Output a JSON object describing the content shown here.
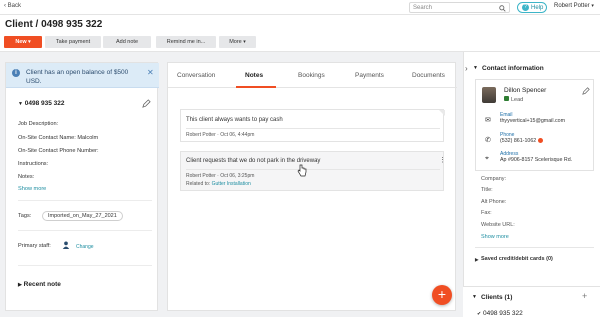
{
  "topbar": {
    "back_label": "Back",
    "search_placeholder": "Search",
    "help_label": "Help",
    "user_name": "Robert Potter"
  },
  "header": {
    "title": "Client / 0498 935 322",
    "buttons": {
      "new": "New",
      "take_payment": "Take payment",
      "add_note": "Add note",
      "remind_me": "Remind me in...",
      "more": "More"
    }
  },
  "left": {
    "alert_text": "Client has an open balance of $500 USD.",
    "phone": "0498 935 322",
    "fields": {
      "job_description": "Job Description:",
      "onsite_name": "On-Site Contact Name: Malcolm",
      "onsite_phone": "On-Site Contact Phone Number:",
      "instructions": "Instructions:",
      "notes": "Notes:"
    },
    "show_more": "Show more",
    "tags_label": "Tags:",
    "tag_value": "Imported_on_May_27_2021",
    "primary_staff_label": "Primary staff:",
    "change_label": "Change",
    "recent_note": "Recent note"
  },
  "middle": {
    "tabs": [
      "Conversation",
      "Notes",
      "Bookings",
      "Payments",
      "Documents"
    ],
    "notes": [
      {
        "text": "This client always wants to pay cash",
        "author": "Robert Potter",
        "date": "Oct 06, 4:44pm"
      },
      {
        "text": "Client requests that we do not park in the driveway",
        "author": "Robert Potter",
        "date": "Oct 06, 3:25pm",
        "related_label": "Related to:",
        "related_link": "Gutter Installation"
      }
    ],
    "fab_label": "+"
  },
  "right": {
    "contact_header": "Contact information",
    "name": "Dillon Spencer",
    "status": "Lead",
    "email_label": "Email",
    "email_value": "thyyvertical+15@gmail.com",
    "phone_label": "Phone",
    "phone_value": "(532) 861-1062",
    "address_label": "Address",
    "address_value": "Ap #906-8157 Scelerisque Rd.",
    "fields": {
      "company": "Company:",
      "title": "Title:",
      "alt_phone": "Alt Phone:",
      "fax": "Fax:",
      "website": "Website URL:"
    },
    "show_more": "Show more",
    "saved_cards": "Saved credit/debit cards (0)",
    "clients_header": "Clients (1)",
    "client_number": "0498 935 322"
  },
  "colors": {
    "accent": "#f04e23",
    "link": "#1e8ea1",
    "alert_bg": "#dcebf7"
  }
}
